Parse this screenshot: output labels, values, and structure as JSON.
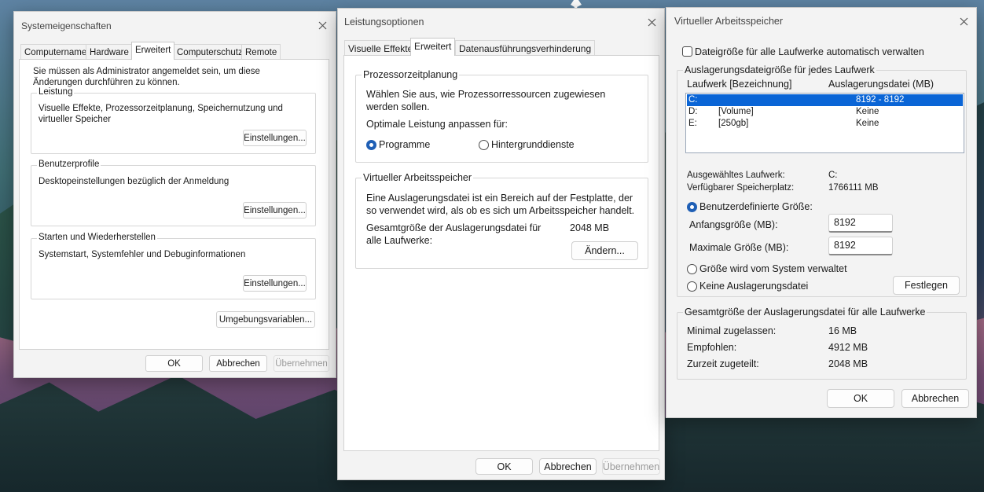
{
  "dialog1": {
    "title": "Systemeigenschaften",
    "tabs": [
      "Computername",
      "Hardware",
      "Erweitert",
      "Computerschutz",
      "Remote"
    ],
    "admin_note": "Sie müssen als Administrator angemeldet sein, um diese Änderungen durchführen zu können.",
    "groups": {
      "leistung": {
        "legend": "Leistung",
        "desc": "Visuelle Effekte, Prozessorzeitplanung, Speichernutzung und virtueller Speicher",
        "button": "Einstellungen..."
      },
      "benutzerprofile": {
        "legend": "Benutzerprofile",
        "desc": "Desktopeinstellungen bezüglich der Anmeldung",
        "button": "Einstellungen..."
      },
      "starten": {
        "legend": "Starten und Wiederherstellen",
        "desc": "Systemstart, Systemfehler und Debuginformationen",
        "button": "Einstellungen..."
      }
    },
    "env_button": "Umgebungsvariablen...",
    "ok": "OK",
    "cancel": "Abbrechen",
    "apply": "Übernehmen"
  },
  "dialog2": {
    "title": "Leistungsoptionen",
    "tabs": [
      "Visuelle Effekte",
      "Erweitert",
      "Datenausführungsverhinderung"
    ],
    "prozessor": {
      "legend": "Prozessorzeitplanung",
      "desc": "Wählen Sie aus, wie Prozessorressourcen zugewiesen werden sollen.",
      "optimal": "Optimale Leistung anpassen für:",
      "radio_programs": "Programme",
      "radio_background": "Hintergrunddienste"
    },
    "virtuell": {
      "legend": "Virtueller Arbeitsspeicher",
      "desc": "Eine Auslagerungsdatei ist ein Bereich auf der Festplatte, der so verwendet wird, als ob es sich um Arbeitsspeicher handelt.",
      "total_label": "Gesamtgröße der Auslagerungsdatei für alle Laufwerke:",
      "total_value": "2048 MB",
      "change_button": "Ändern..."
    },
    "ok": "OK",
    "cancel": "Abbrechen",
    "apply": "Übernehmen"
  },
  "dialog3": {
    "title": "Virtueller Arbeitsspeicher",
    "auto_checkbox": "Dateigröße für alle Laufwerke automatisch verwalten",
    "per_drive_legend": "Auslagerungsdateigröße für jedes Laufwerk",
    "col_drive": "Laufwerk [Bezeichnung]",
    "col_file": "Auslagerungsdatei (MB)",
    "drives": [
      {
        "drive": "C:",
        "label": "",
        "size": "8192 - 8192"
      },
      {
        "drive": "D:",
        "label": "[Volume]",
        "size": "Keine"
      },
      {
        "drive": "E:",
        "label": "[250gb]",
        "size": "Keine"
      }
    ],
    "selected_drive_label": "Ausgewähltes Laufwerk:",
    "selected_drive_value": "C:",
    "free_space_label": "Verfügbarer Speicherplatz:",
    "free_space_value": "1766111 MB",
    "radio_custom": "Benutzerdefinierte Größe:",
    "initial_label": "Anfangsgröße (MB):",
    "initial_value": "8192",
    "max_label": "Maximale Größe (MB):",
    "max_value": "8192",
    "radio_system": "Größe wird vom System verwaltet",
    "radio_none": "Keine Auslagerungsdatei",
    "set_button": "Festlegen",
    "total_legend": "Gesamtgröße der Auslagerungsdatei für alle Laufwerke",
    "min_label": "Minimal zugelassen:",
    "min_value": "16 MB",
    "rec_label": "Empfohlen:",
    "rec_value": "4912 MB",
    "cur_label": "Zurzeit zugeteilt:",
    "cur_value": "2048 MB",
    "ok": "OK",
    "cancel": "Abbrechen"
  }
}
